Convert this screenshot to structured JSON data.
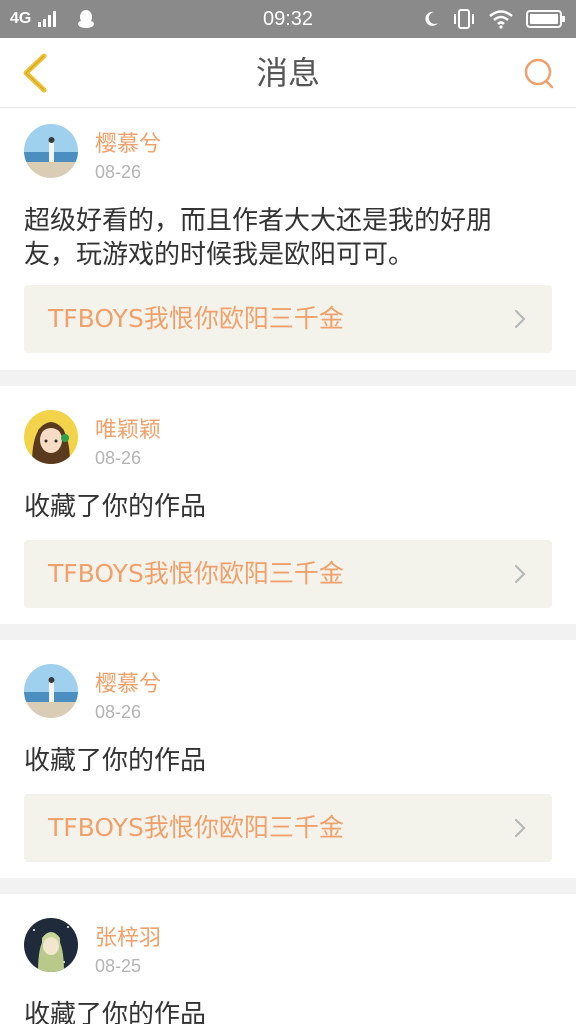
{
  "status_bar": {
    "network": "4G",
    "time": "09:32"
  },
  "nav": {
    "title": "消息"
  },
  "colors": {
    "accent": "#f0a06a",
    "back_icon": "#f3c234",
    "search_icon": "#f0a06a"
  },
  "messages": [
    {
      "username": "樱慕兮",
      "date": "08-26",
      "text_line1": "超级好看的，而且作者大大还是我的好朋",
      "text_line2": "友，玩游戏的时候我是欧阳可可。",
      "work_title": "TFBOYS我恨你欧阳三千金",
      "avatar_icon": "beach-avatar"
    },
    {
      "username": "唯颖颖",
      "date": "08-26",
      "text_line1": "收藏了你的作品",
      "work_title": "TFBOYS我恨你欧阳三千金",
      "avatar_icon": "anime-girl-avatar"
    },
    {
      "username": "樱慕兮",
      "date": "08-26",
      "text_line1": "收藏了你的作品",
      "work_title": "TFBOYS我恨你欧阳三千金",
      "avatar_icon": "beach-avatar"
    },
    {
      "username": "张梓羽",
      "date": "08-25",
      "text_line1": "收藏了你的作品",
      "avatar_icon": "dark-anime-avatar"
    }
  ]
}
